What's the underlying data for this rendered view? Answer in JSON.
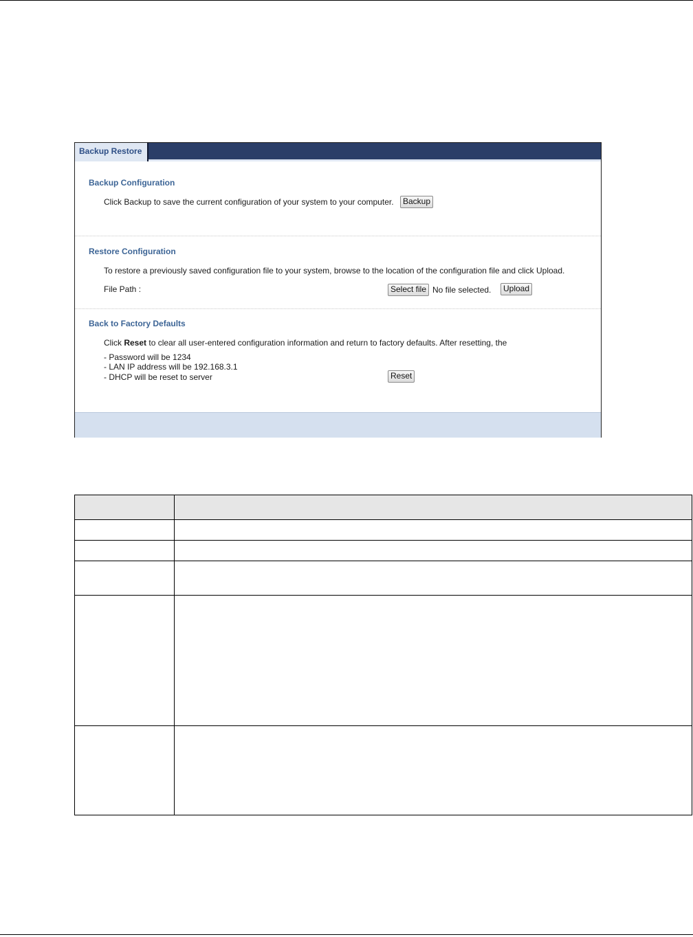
{
  "tab": {
    "label": "Backup Restore"
  },
  "backup": {
    "title": "Backup Configuration",
    "description": "Click Backup to save the current configuration of your system to your computer.",
    "button": "Backup"
  },
  "restore": {
    "title": "Restore Configuration",
    "description": "To restore a previously saved configuration file to your system, browse to the location of the configuration file and click Upload.",
    "file_path_label": "File Path :",
    "select_file_button": "Select file",
    "file_status": "No file selected.",
    "upload_button": "Upload"
  },
  "factory": {
    "title": "Back to Factory Defaults",
    "desc_prefix": "Click ",
    "desc_bold": "Reset",
    "desc_suffix": " to clear all user-entered configuration information and return to factory defaults. After resetting, the",
    "items": [
      "- Password will be 1234",
      "- LAN IP address will be 192.168.3.1",
      "- DHCP will be reset to server"
    ],
    "reset_button": "Reset"
  },
  "colors": {
    "tab_bar": "#2b3e68",
    "tab_bg": "#dfe7f3",
    "section_title": "#3d6596",
    "footer_bar": "#d5e0ef"
  }
}
